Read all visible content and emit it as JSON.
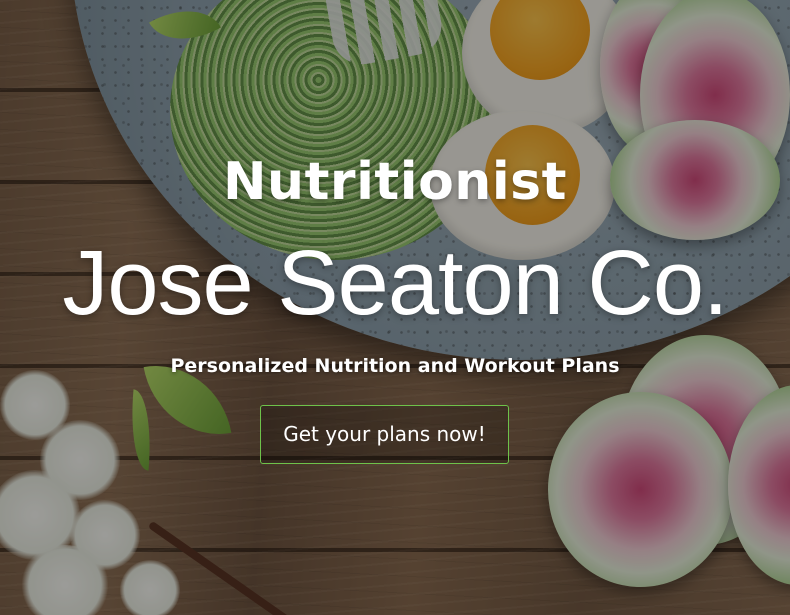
{
  "hero": {
    "kicker": "Nutritionist",
    "brand": "Jose Seaton Co.",
    "tagline": "Personalized Nutrition and Workout Plans",
    "cta_label": "Get your plans now!"
  },
  "colors": {
    "cta_border": "#6ec24a",
    "text": "#ffffff",
    "overlay": "rgba(0,0,0,0.38)"
  },
  "background": {
    "image_subject": "salad-bowl-on-wooden-table"
  }
}
